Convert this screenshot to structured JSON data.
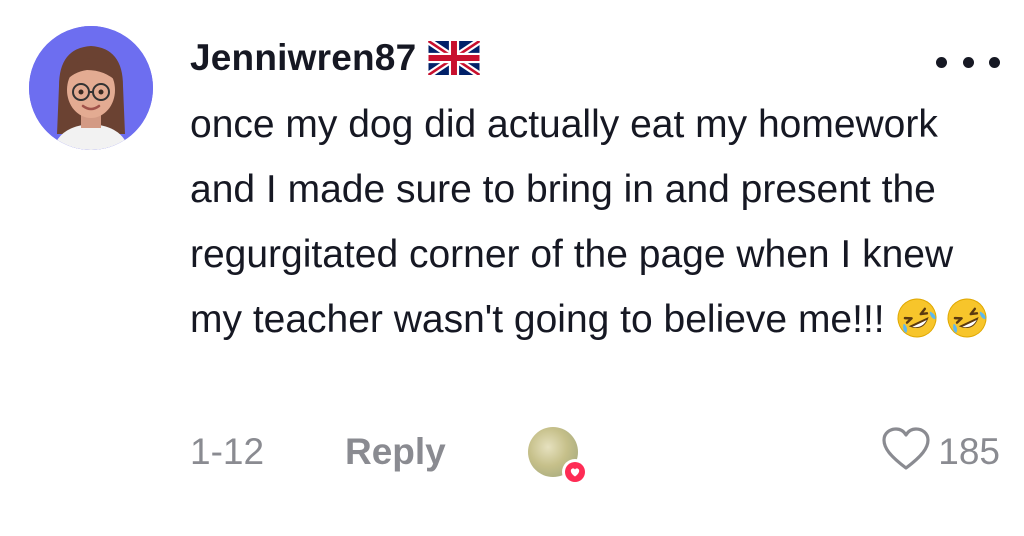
{
  "comment": {
    "username": "Jenniwren87",
    "flag_icon": "uk-flag-icon",
    "text": "once my dog did actually eat my homework and I made sure to bring in and present the regurgitated corner of the page when I knew my teacher wasn't going to believe me!!!",
    "emojis": [
      "rolling-on-floor-laughing-icon",
      "rolling-on-floor-laughing-icon"
    ],
    "timestamp": "1-12",
    "reply_label": "Reply",
    "like_count": "185",
    "more_icon": "more-options-icon"
  },
  "colors": {
    "avatar_bg": "#6d6ef0",
    "text": "#161823",
    "muted": "#8a8b91",
    "heart_badge": "#fe2c55"
  }
}
